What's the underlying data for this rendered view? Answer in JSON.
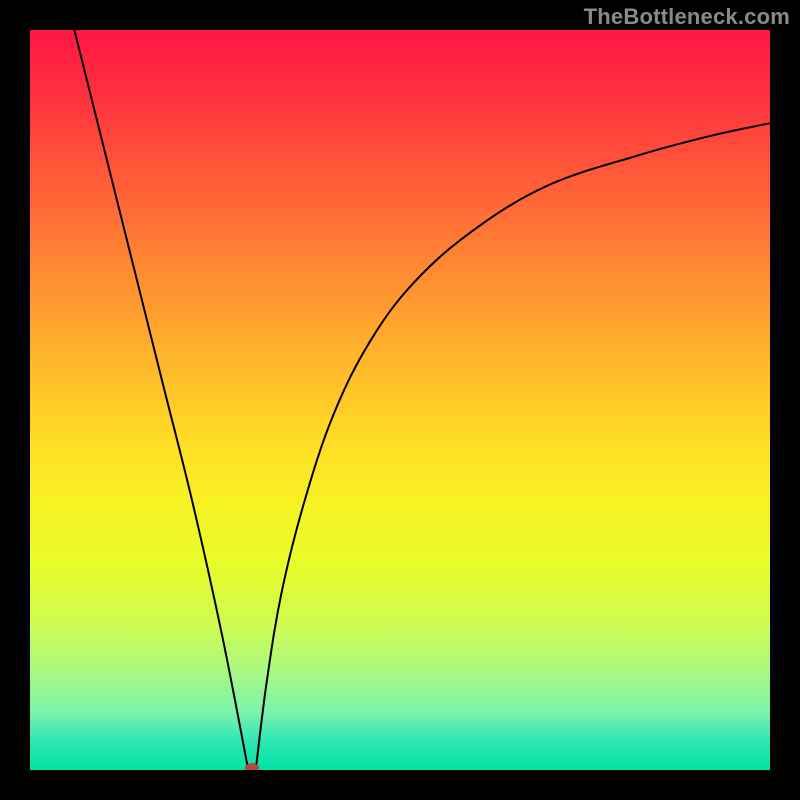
{
  "watermark": "TheBottleneck.com",
  "chart_data": {
    "type": "line",
    "title": "",
    "xlabel": "",
    "ylabel": "",
    "xlim": [
      0,
      100
    ],
    "ylim": [
      0,
      100
    ],
    "series": [
      {
        "name": "left-branch",
        "x": [
          6,
          10,
          14,
          18,
          22,
          26,
          29.5
        ],
        "y": [
          100,
          84,
          68,
          52,
          36,
          18,
          0
        ]
      },
      {
        "name": "right-branch",
        "x": [
          30.5,
          32,
          34,
          37,
          41,
          46,
          52,
          60,
          70,
          82,
          92,
          100
        ],
        "y": [
          0,
          12,
          24,
          36,
          48,
          58,
          66,
          73,
          79,
          83,
          85.7,
          87.4
        ]
      }
    ],
    "marker": {
      "x": 30,
      "y": 0,
      "color": "#b8453f"
    }
  }
}
